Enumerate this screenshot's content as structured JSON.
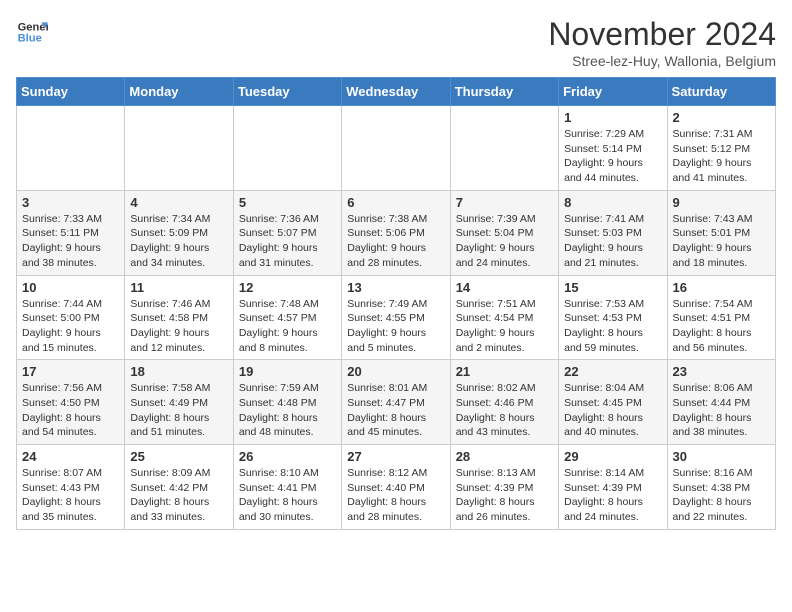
{
  "header": {
    "logo_line1": "General",
    "logo_line2": "Blue",
    "month_title": "November 2024",
    "location": "Stree-lez-Huy, Wallonia, Belgium"
  },
  "weekdays": [
    "Sunday",
    "Monday",
    "Tuesday",
    "Wednesday",
    "Thursday",
    "Friday",
    "Saturday"
  ],
  "weeks": [
    [
      {
        "day": "",
        "content": ""
      },
      {
        "day": "",
        "content": ""
      },
      {
        "day": "",
        "content": ""
      },
      {
        "day": "",
        "content": ""
      },
      {
        "day": "",
        "content": ""
      },
      {
        "day": "1",
        "content": "Sunrise: 7:29 AM\nSunset: 5:14 PM\nDaylight: 9 hours and 44 minutes."
      },
      {
        "day": "2",
        "content": "Sunrise: 7:31 AM\nSunset: 5:12 PM\nDaylight: 9 hours and 41 minutes."
      }
    ],
    [
      {
        "day": "3",
        "content": "Sunrise: 7:33 AM\nSunset: 5:11 PM\nDaylight: 9 hours and 38 minutes."
      },
      {
        "day": "4",
        "content": "Sunrise: 7:34 AM\nSunset: 5:09 PM\nDaylight: 9 hours and 34 minutes."
      },
      {
        "day": "5",
        "content": "Sunrise: 7:36 AM\nSunset: 5:07 PM\nDaylight: 9 hours and 31 minutes."
      },
      {
        "day": "6",
        "content": "Sunrise: 7:38 AM\nSunset: 5:06 PM\nDaylight: 9 hours and 28 minutes."
      },
      {
        "day": "7",
        "content": "Sunrise: 7:39 AM\nSunset: 5:04 PM\nDaylight: 9 hours and 24 minutes."
      },
      {
        "day": "8",
        "content": "Sunrise: 7:41 AM\nSunset: 5:03 PM\nDaylight: 9 hours and 21 minutes."
      },
      {
        "day": "9",
        "content": "Sunrise: 7:43 AM\nSunset: 5:01 PM\nDaylight: 9 hours and 18 minutes."
      }
    ],
    [
      {
        "day": "10",
        "content": "Sunrise: 7:44 AM\nSunset: 5:00 PM\nDaylight: 9 hours and 15 minutes."
      },
      {
        "day": "11",
        "content": "Sunrise: 7:46 AM\nSunset: 4:58 PM\nDaylight: 9 hours and 12 minutes."
      },
      {
        "day": "12",
        "content": "Sunrise: 7:48 AM\nSunset: 4:57 PM\nDaylight: 9 hours and 8 minutes."
      },
      {
        "day": "13",
        "content": "Sunrise: 7:49 AM\nSunset: 4:55 PM\nDaylight: 9 hours and 5 minutes."
      },
      {
        "day": "14",
        "content": "Sunrise: 7:51 AM\nSunset: 4:54 PM\nDaylight: 9 hours and 2 minutes."
      },
      {
        "day": "15",
        "content": "Sunrise: 7:53 AM\nSunset: 4:53 PM\nDaylight: 8 hours and 59 minutes."
      },
      {
        "day": "16",
        "content": "Sunrise: 7:54 AM\nSunset: 4:51 PM\nDaylight: 8 hours and 56 minutes."
      }
    ],
    [
      {
        "day": "17",
        "content": "Sunrise: 7:56 AM\nSunset: 4:50 PM\nDaylight: 8 hours and 54 minutes."
      },
      {
        "day": "18",
        "content": "Sunrise: 7:58 AM\nSunset: 4:49 PM\nDaylight: 8 hours and 51 minutes."
      },
      {
        "day": "19",
        "content": "Sunrise: 7:59 AM\nSunset: 4:48 PM\nDaylight: 8 hours and 48 minutes."
      },
      {
        "day": "20",
        "content": "Sunrise: 8:01 AM\nSunset: 4:47 PM\nDaylight: 8 hours and 45 minutes."
      },
      {
        "day": "21",
        "content": "Sunrise: 8:02 AM\nSunset: 4:46 PM\nDaylight: 8 hours and 43 minutes."
      },
      {
        "day": "22",
        "content": "Sunrise: 8:04 AM\nSunset: 4:45 PM\nDaylight: 8 hours and 40 minutes."
      },
      {
        "day": "23",
        "content": "Sunrise: 8:06 AM\nSunset: 4:44 PM\nDaylight: 8 hours and 38 minutes."
      }
    ],
    [
      {
        "day": "24",
        "content": "Sunrise: 8:07 AM\nSunset: 4:43 PM\nDaylight: 8 hours and 35 minutes."
      },
      {
        "day": "25",
        "content": "Sunrise: 8:09 AM\nSunset: 4:42 PM\nDaylight: 8 hours and 33 minutes."
      },
      {
        "day": "26",
        "content": "Sunrise: 8:10 AM\nSunset: 4:41 PM\nDaylight: 8 hours and 30 minutes."
      },
      {
        "day": "27",
        "content": "Sunrise: 8:12 AM\nSunset: 4:40 PM\nDaylight: 8 hours and 28 minutes."
      },
      {
        "day": "28",
        "content": "Sunrise: 8:13 AM\nSunset: 4:39 PM\nDaylight: 8 hours and 26 minutes."
      },
      {
        "day": "29",
        "content": "Sunrise: 8:14 AM\nSunset: 4:39 PM\nDaylight: 8 hours and 24 minutes."
      },
      {
        "day": "30",
        "content": "Sunrise: 8:16 AM\nSunset: 4:38 PM\nDaylight: 8 hours and 22 minutes."
      }
    ]
  ]
}
